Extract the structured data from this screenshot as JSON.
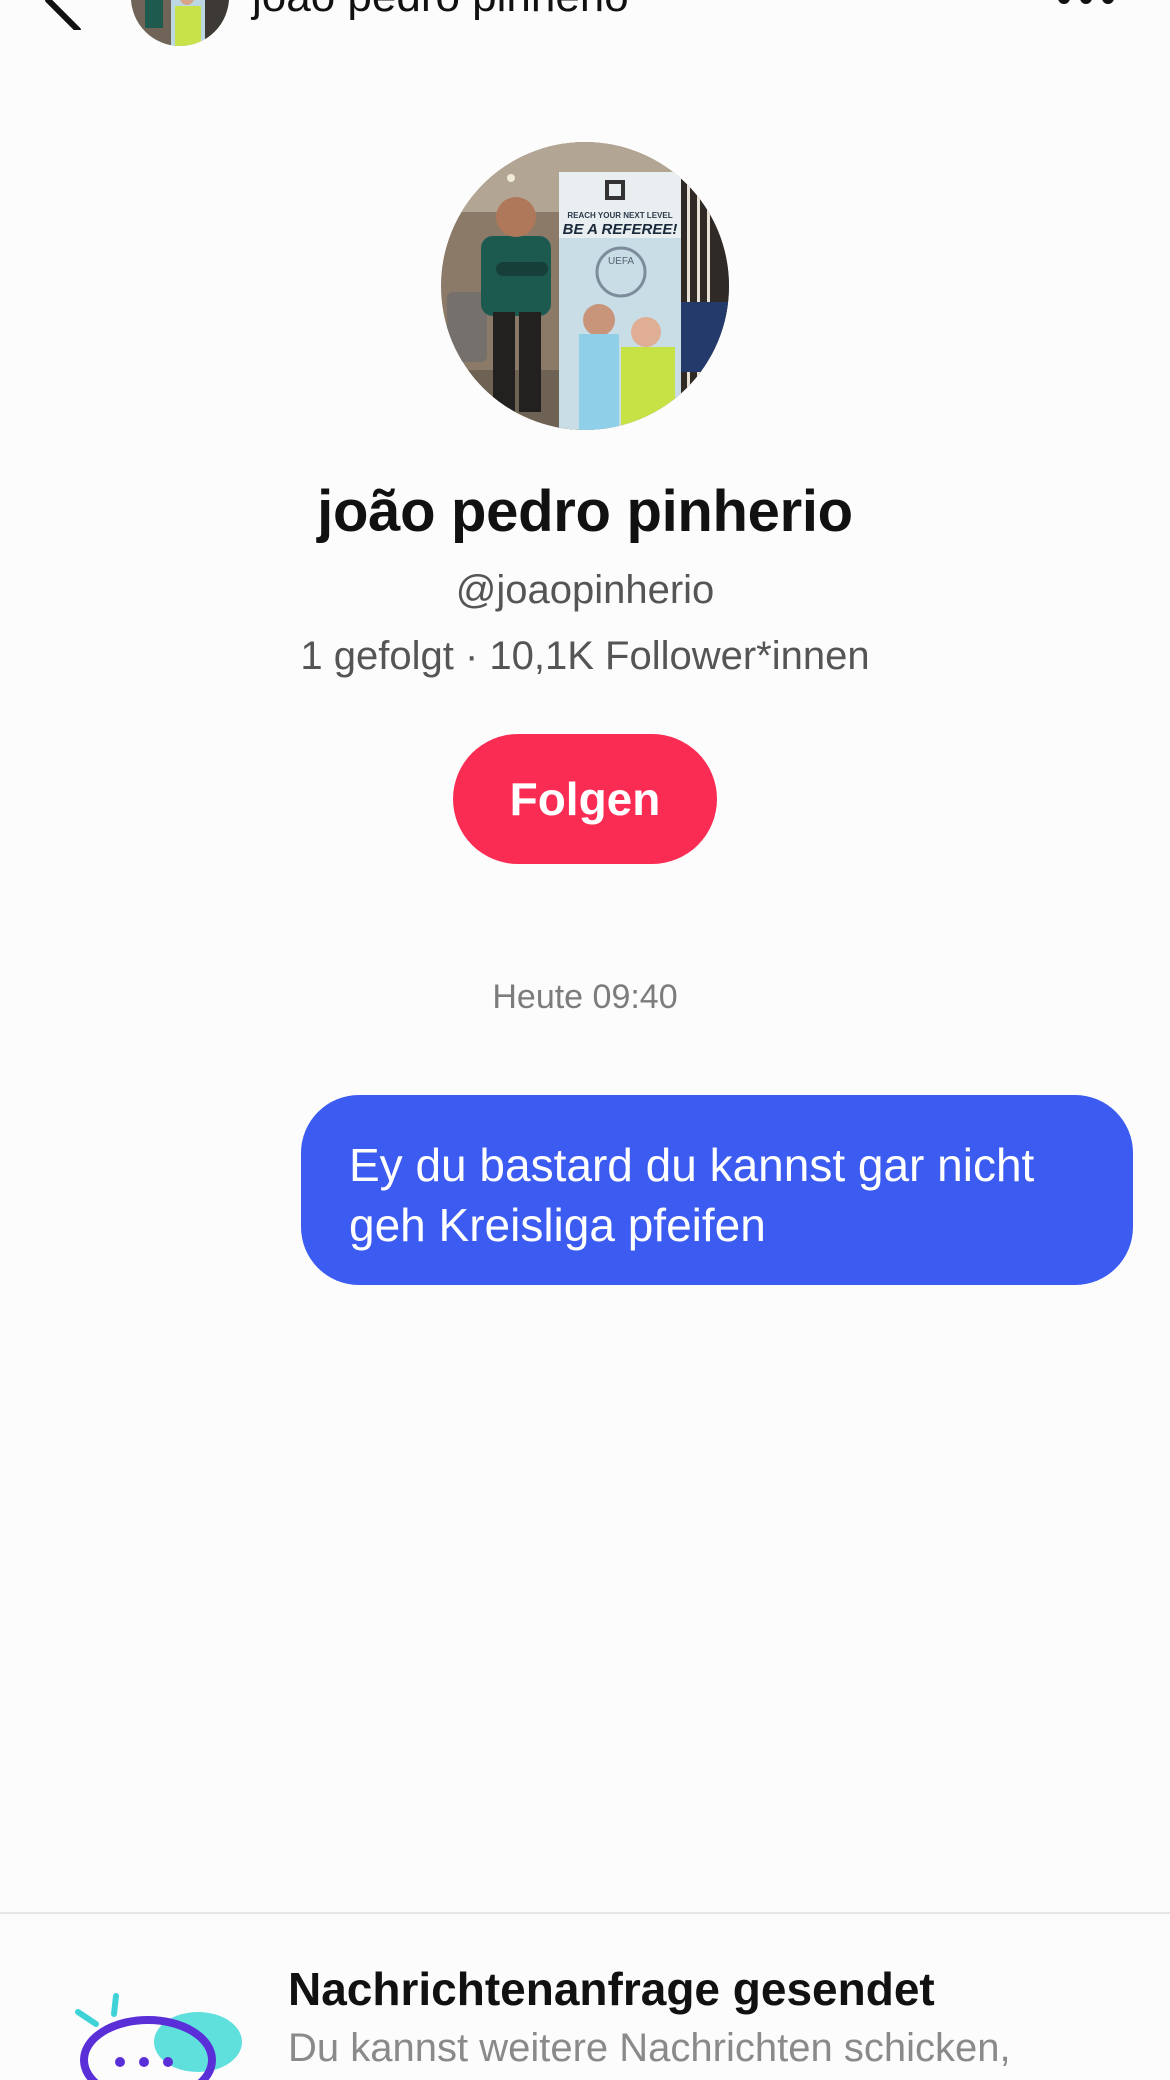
{
  "header": {
    "name": "joão pedro pinherio",
    "back_icon": "chevron-left-icon",
    "more_icon": "more-horizontal-icon"
  },
  "profile": {
    "display_name": "joão pedro pinherio",
    "username": "@joaopinherio",
    "stats": "1 gefolgt · 10,1K Follower*innen",
    "follow_label": "Folgen",
    "avatar_poster_line1": "REACH YOUR NEXT LEVEL",
    "avatar_poster_line2": "BE A REFEREE!",
    "avatar_poster_logo": "UEFA"
  },
  "chat": {
    "timestamp": "Heute 09:40",
    "messages": [
      {
        "direction": "outgoing",
        "text": "Ey du bastard du kannst gar nicht geh Kreisliga pfeifen"
      }
    ]
  },
  "request_banner": {
    "title": "Nachrichtenanfrage gesendet",
    "text": "Du kannst weitere Nachrichten schicken,",
    "icon": "chat-bubbles-icon"
  },
  "colors": {
    "follow_button": "#fb2c54",
    "outgoing_bubble": "#3b5bf1",
    "background": "#fdfcfd"
  }
}
